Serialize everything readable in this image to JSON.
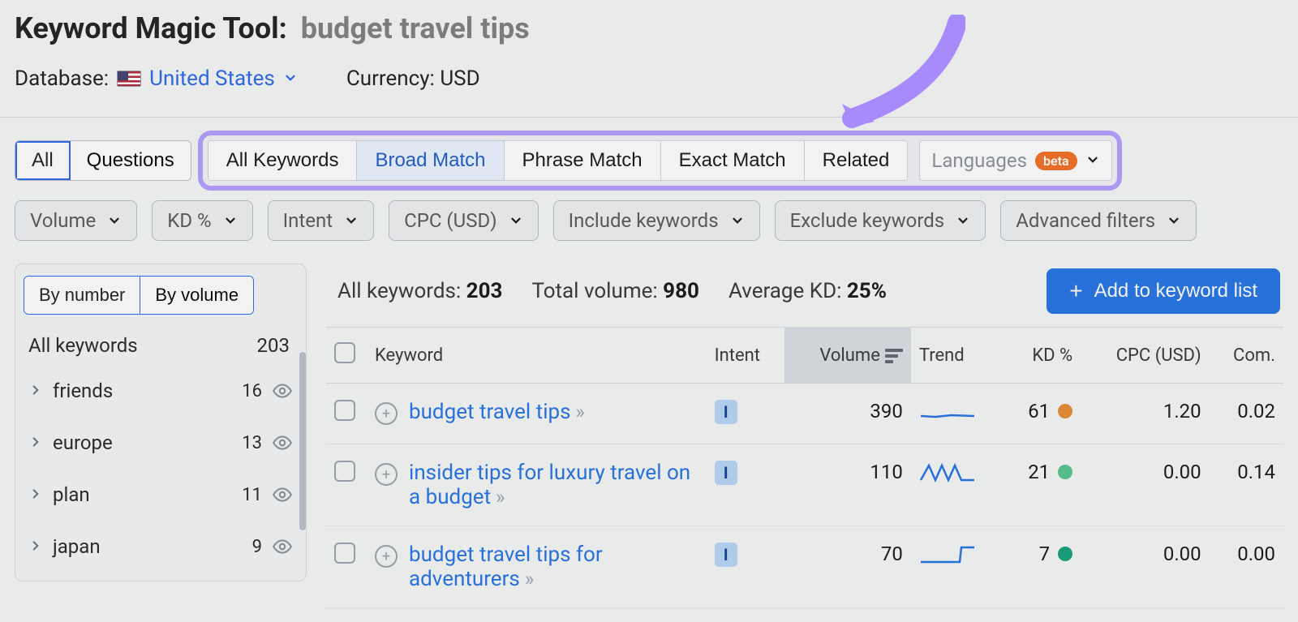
{
  "header": {
    "tool_label": "Keyword Magic Tool:",
    "query": "budget travel tips",
    "database_label": "Database:",
    "database_value": "United States",
    "currency_label": "Currency:",
    "currency_value": "USD"
  },
  "tabs": {
    "all": "All",
    "questions": "Questions"
  },
  "match": {
    "all_keywords": "All Keywords",
    "broad": "Broad Match",
    "phrase": "Phrase Match",
    "exact": "Exact Match",
    "related": "Related",
    "languages": "Languages",
    "beta": "beta"
  },
  "filters": {
    "volume": "Volume",
    "kd": "KD %",
    "intent": "Intent",
    "cpc": "CPC (USD)",
    "include": "Include keywords",
    "exclude": "Exclude keywords",
    "advanced": "Advanced filters"
  },
  "sidebar": {
    "sort_by_number": "By number",
    "sort_by_volume": "By volume",
    "all_keywords_label": "All keywords",
    "all_keywords_count": "203",
    "groups": [
      {
        "name": "friends",
        "count": "16"
      },
      {
        "name": "europe",
        "count": "13"
      },
      {
        "name": "plan",
        "count": "11"
      },
      {
        "name": "japan",
        "count": "9"
      }
    ]
  },
  "summary": {
    "all_keywords_label": "All keywords:",
    "all_keywords_value": "203",
    "total_volume_label": "Total volume:",
    "total_volume_value": "980",
    "avg_kd_label": "Average KD:",
    "avg_kd_value": "25%",
    "add_button": "Add to keyword list"
  },
  "columns": {
    "keyword": "Keyword",
    "intent": "Intent",
    "volume": "Volume",
    "trend": "Trend",
    "kd": "KD %",
    "cpc": "CPC (USD)",
    "com": "Com."
  },
  "rows": [
    {
      "keyword": "budget travel tips",
      "intent": "I",
      "volume": "390",
      "kd": "61",
      "kd_color": "orange",
      "cpc": "1.20",
      "com": "0.02",
      "spark": "flat"
    },
    {
      "keyword": "insider tips for luxury travel on a budget",
      "intent": "I",
      "volume": "110",
      "kd": "21",
      "kd_color": "green",
      "cpc": "0.00",
      "com": "0.14",
      "spark": "spiky"
    },
    {
      "keyword": "budget travel tips for adventurers",
      "intent": "I",
      "volume": "70",
      "kd": "7",
      "kd_color": "teal",
      "cpc": "0.00",
      "com": "0.00",
      "spark": "step"
    }
  ]
}
